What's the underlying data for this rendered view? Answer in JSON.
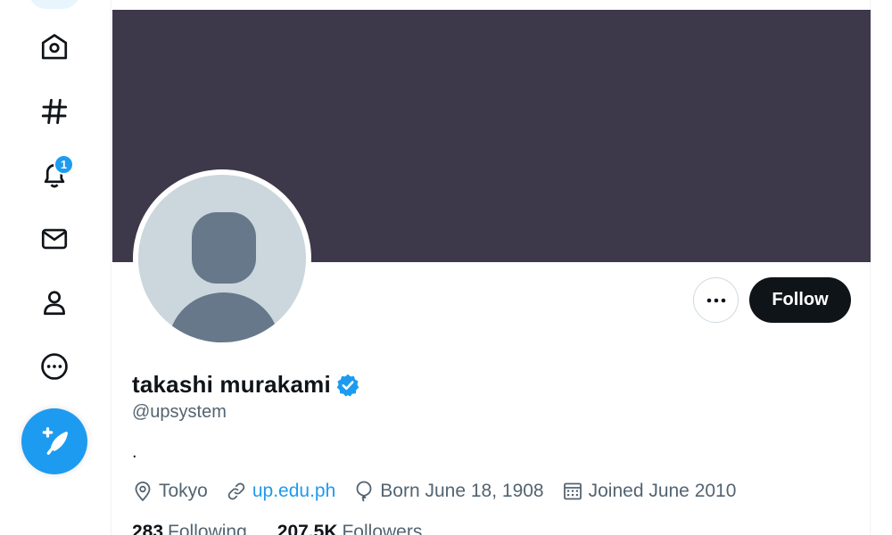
{
  "nav": {
    "notifications_badge": "1",
    "items": [
      {
        "icon": "home-icon"
      },
      {
        "icon": "hashtag-icon"
      },
      {
        "icon": "bell-icon"
      },
      {
        "icon": "mail-icon"
      },
      {
        "icon": "user-icon"
      },
      {
        "icon": "more-circle-icon"
      }
    ],
    "compose_icon": "feather-plus-icon"
  },
  "profile": {
    "display_name": "takashi murakami",
    "verified": true,
    "handle": "@upsystem",
    "bio": ".",
    "location": "Tokyo",
    "website": "up.edu.ph",
    "birthday": "Born June 18, 1908",
    "joined": "Joined June 2010",
    "following_count": "283",
    "following_label": "Following",
    "followers_count": "207.5K",
    "followers_label": "Followers",
    "follow_label": "Follow"
  },
  "colors": {
    "accent": "#1d9bf0",
    "banner": "#3e384b",
    "text_primary": "#0f1419",
    "text_secondary": "#536471",
    "avatar_bg": "#ccd6dd",
    "avatar_figure": "#66788a"
  }
}
